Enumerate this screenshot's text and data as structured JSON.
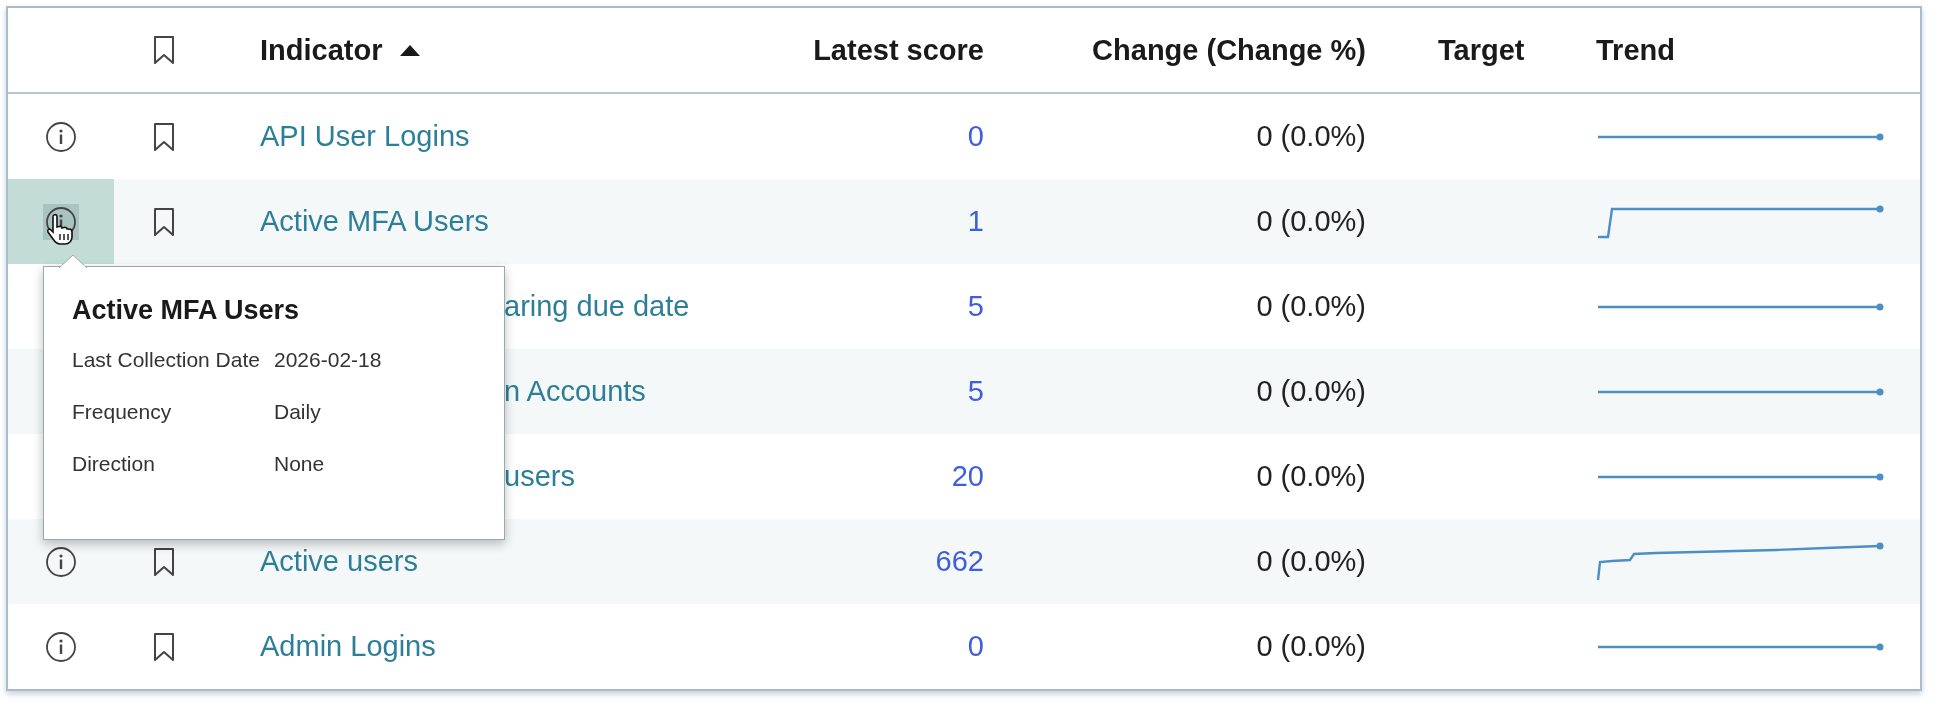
{
  "table": {
    "columns": [
      {
        "kind": "blank"
      },
      {
        "kind": "bookmark"
      },
      {
        "label": "Indicator",
        "sorted": true
      },
      {
        "label": "Latest score"
      },
      {
        "label": "Change (Change %)"
      },
      {
        "label": "Target"
      },
      {
        "label": "Trend"
      }
    ],
    "rows": [
      {
        "indicator": "API User Logins",
        "score": "0",
        "change": "0 (0.0%)",
        "kind": "flat",
        "covered": false,
        "hovered": false
      },
      {
        "indicator": "Active MFA Users",
        "score": "1",
        "change": "0 (0.0%)",
        "kind": "step",
        "covered": false,
        "hovered": true
      },
      {
        "indicator": "aring due date",
        "score": "5",
        "change": "0 (0.0%)",
        "kind": "flat",
        "covered": true,
        "hovered": false
      },
      {
        "indicator": "n Accounts",
        "score": "5",
        "change": "0 (0.0%)",
        "kind": "flat",
        "covered": true,
        "hovered": false
      },
      {
        "indicator": "users",
        "score": "20",
        "change": "0 (0.0%)",
        "kind": "flat",
        "covered": true,
        "hovered": false
      },
      {
        "indicator": "Active users",
        "score": "662",
        "change": "0 (0.0%)",
        "kind": "climb",
        "covered": false,
        "hovered": false
      },
      {
        "indicator": "Admin Logins",
        "score": "0",
        "change": "0 (0.0%)",
        "kind": "flat",
        "covered": false,
        "hovered": false
      }
    ]
  },
  "tooltip": {
    "title": "Active MFA Users",
    "rows": [
      {
        "label": "Last Collection Date",
        "value": "2026-02-18"
      },
      {
        "label": "Frequency",
        "value": "Daily"
      },
      {
        "label": "Direction",
        "value": "None"
      }
    ]
  }
}
